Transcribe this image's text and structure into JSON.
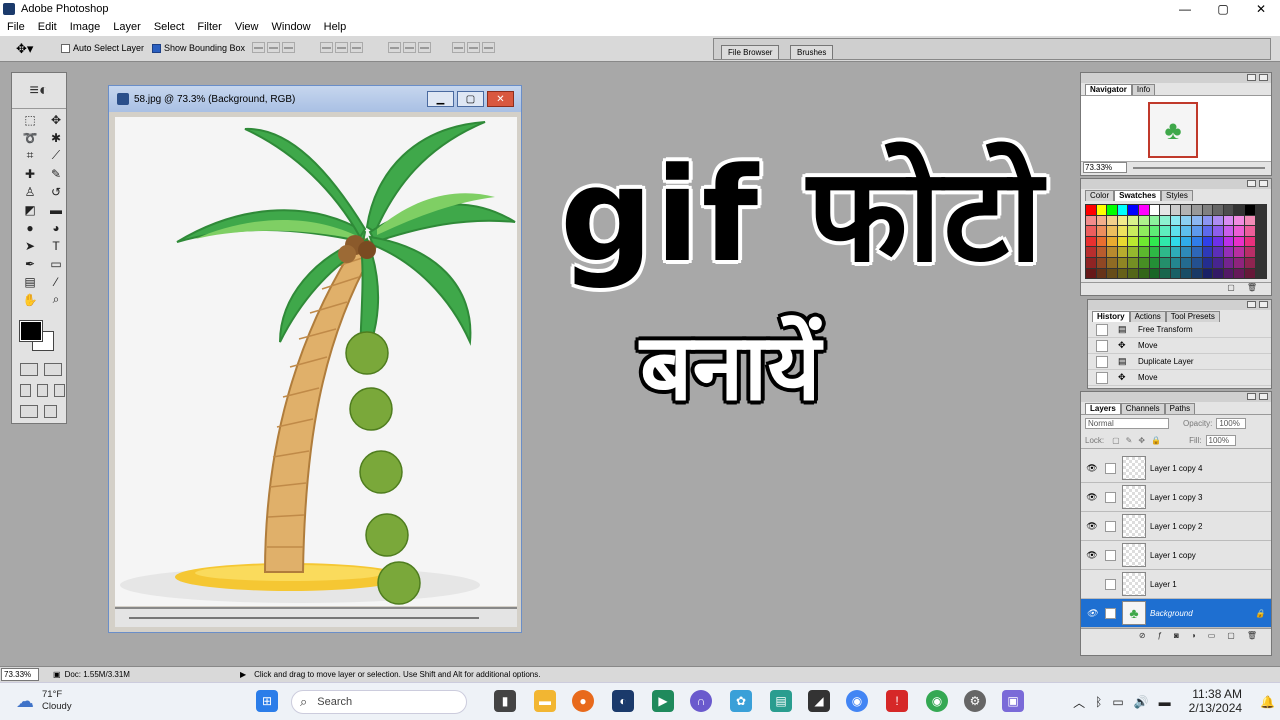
{
  "window": {
    "title": "Adobe Photoshop",
    "controls": [
      "—",
      "▢",
      "✕"
    ]
  },
  "menu": [
    "File",
    "Edit",
    "Image",
    "Layer",
    "Select",
    "Filter",
    "View",
    "Window",
    "Help"
  ],
  "options": {
    "auto_select": "Auto Select Layer",
    "auto_select_checked": false,
    "bounding_box": "Show Bounding Box",
    "bounding_box_checked": true
  },
  "palette_well": {
    "tabs": [
      "File Browser",
      "Brushes"
    ]
  },
  "document": {
    "title": "58.jpg @ 73.3% (Background, RGB)",
    "buttons": [
      "▁",
      "▢",
      "✕"
    ]
  },
  "headline": {
    "line1": "gif फोटो",
    "line2": "बनायें"
  },
  "navigator": {
    "tabs": [
      "Navigator",
      "Info"
    ],
    "zoom": "73.33%"
  },
  "swatches": {
    "tabs": [
      "Color",
      "Swatches",
      "Styles"
    ]
  },
  "history": {
    "tabs": [
      "History",
      "Actions",
      "Tool Presets"
    ],
    "items": [
      "Free Transform",
      "Move",
      "Duplicate Layer",
      "Move"
    ]
  },
  "layers": {
    "tabs": [
      "Layers",
      "Channels",
      "Paths"
    ],
    "blend_mode": "Normal",
    "opacity_label": "Opacity:",
    "opacity": "100%",
    "lock_label": "Lock:",
    "fill_label": "Fill:",
    "fill": "100%",
    "items": [
      "Layer 1 copy 4",
      "Layer 1 copy 3",
      "Layer 1 copy 2",
      "Layer 1 copy",
      "Layer 1",
      "Background"
    ]
  },
  "status": {
    "zoom": "73.33%",
    "doc": "Doc: 1.55M/3.31M",
    "hint": "Click and drag to move layer or selection.  Use Shift and Alt for additional options."
  },
  "taskbar": {
    "temp": "71°F",
    "weather": "Cloudy",
    "search_placeholder": "Search",
    "time": "11:38 AM",
    "date": "2/13/2024"
  },
  "colors": {
    "selection_blue": "#1e6fd1",
    "canvas_bg": "#a8a8a8",
    "palm_green": "#3fa84a"
  }
}
